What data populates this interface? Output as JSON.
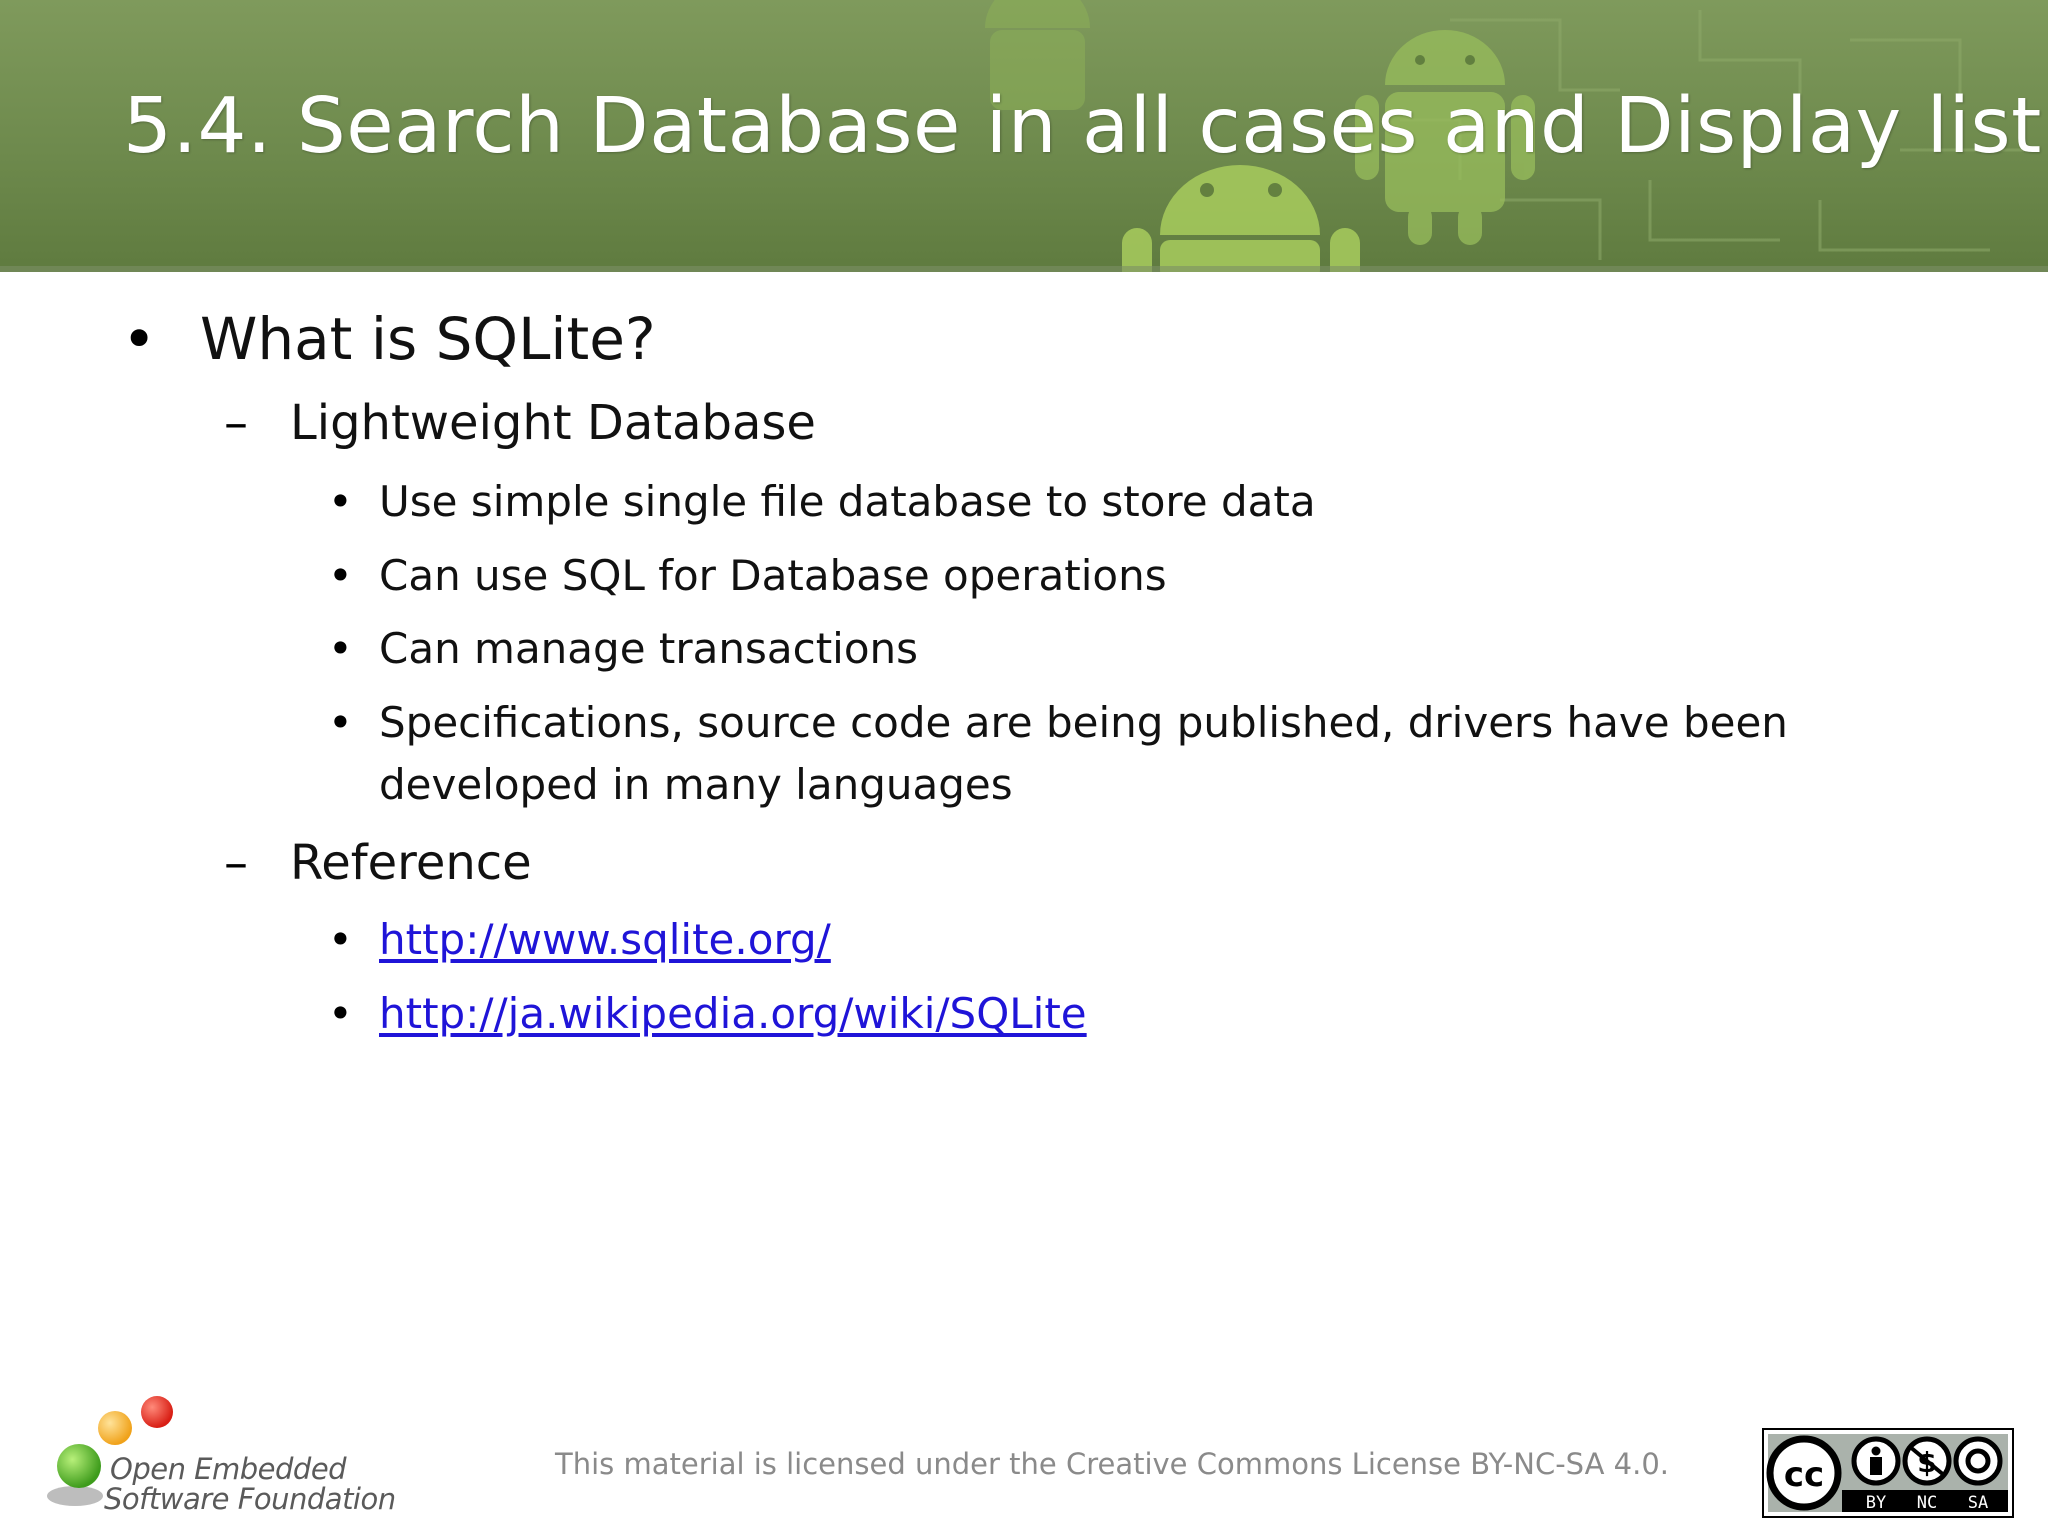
{
  "slide": {
    "title": "5.4. Search Database in all cases and Display list"
  },
  "content": {
    "heading": "What is SQLite?",
    "sections": [
      {
        "label": "Lightweight Database",
        "items": [
          "Use simple single file database to store data",
          "Can use SQL for Database operations",
          "Can manage transactions",
          "Specifications, source code are being published, drivers have been",
          "developed in many languages"
        ]
      },
      {
        "label": "Reference",
        "links": [
          "http://www.sqlite.org/",
          "http://ja.wikipedia.org/wiki/SQLite"
        ]
      }
    ],
    "bullet_l1": "•",
    "bullet_l2": "–",
    "bullet_l3": "•"
  },
  "footer": {
    "license_text": "This material is licensed under the Creative Commons License BY-NC-SA 4.0.",
    "logo_line1": "Open Embedded",
    "logo_line2": "Software Foundation",
    "cc_badge": {
      "cc": "cc",
      "by": "BY",
      "nc": "NC",
      "sa": "SA"
    }
  },
  "colors": {
    "header_green": "#6e8a4d",
    "link_blue": "#1f14d8",
    "footer_gray": "#8a8a8a"
  }
}
